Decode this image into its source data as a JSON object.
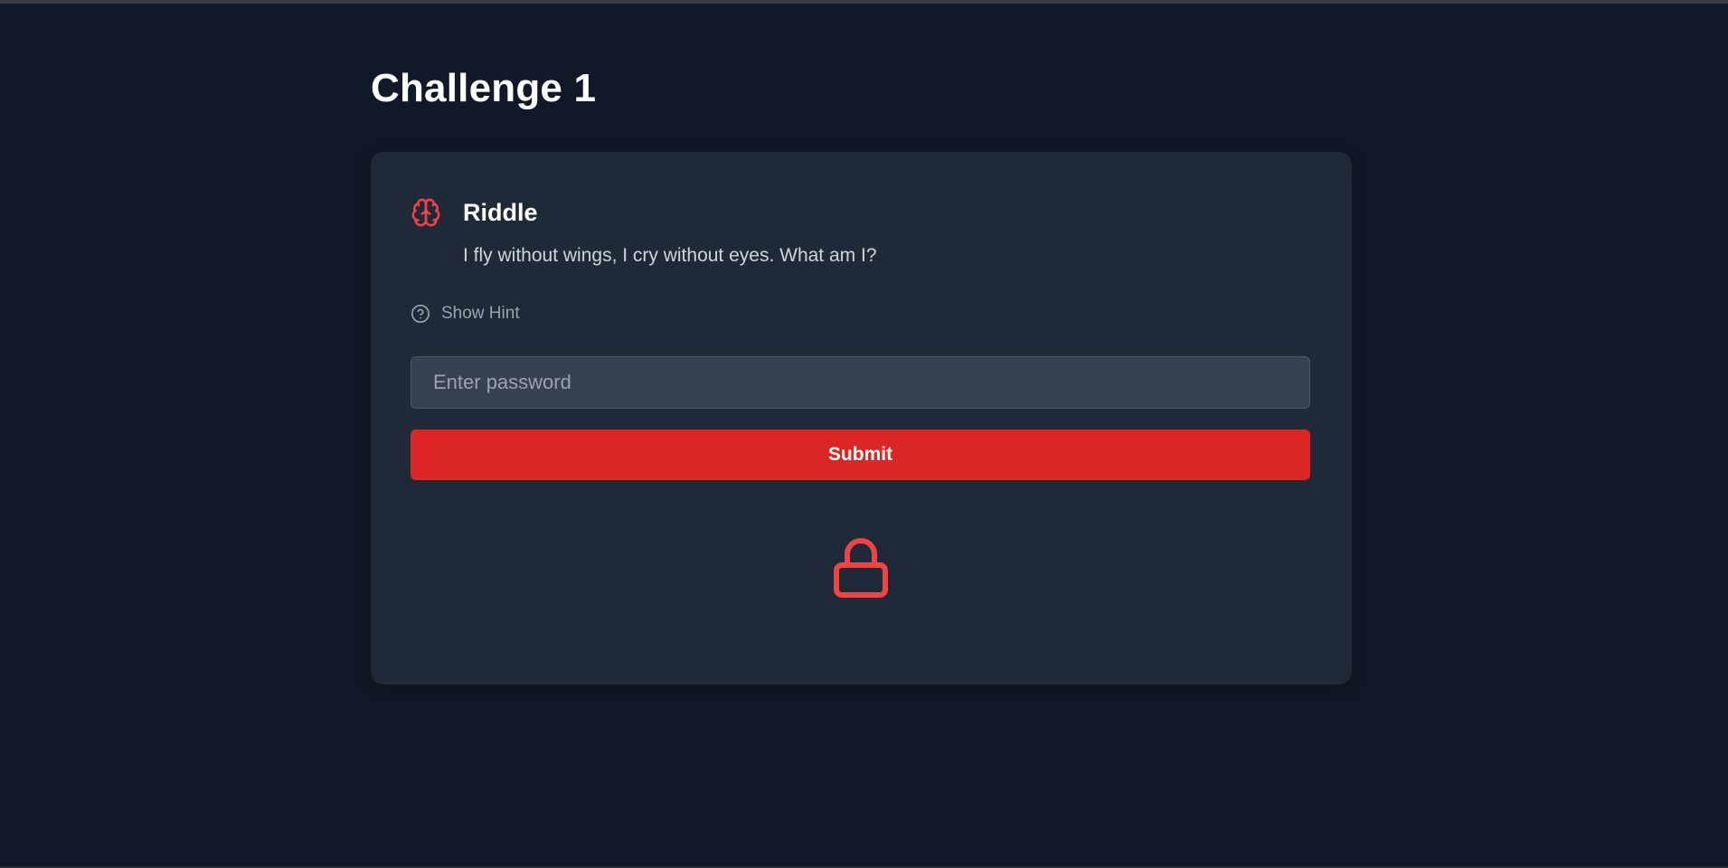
{
  "page": {
    "title": "Challenge 1"
  },
  "riddle": {
    "icon": "brain-icon",
    "heading": "Riddle",
    "text": "I fly without wings, I cry without eyes. What am I?"
  },
  "hint": {
    "icon": "help-circle-icon",
    "label": "Show Hint"
  },
  "password": {
    "placeholder": "Enter password",
    "value": ""
  },
  "submit": {
    "label": "Submit"
  },
  "status": {
    "icon": "lock-icon"
  },
  "colors": {
    "background": "#111827",
    "card": "#1f2937",
    "accent": "#dc2626",
    "icon_red": "#ef4444",
    "input_bg": "#374151",
    "muted_text": "#9ca3af"
  }
}
